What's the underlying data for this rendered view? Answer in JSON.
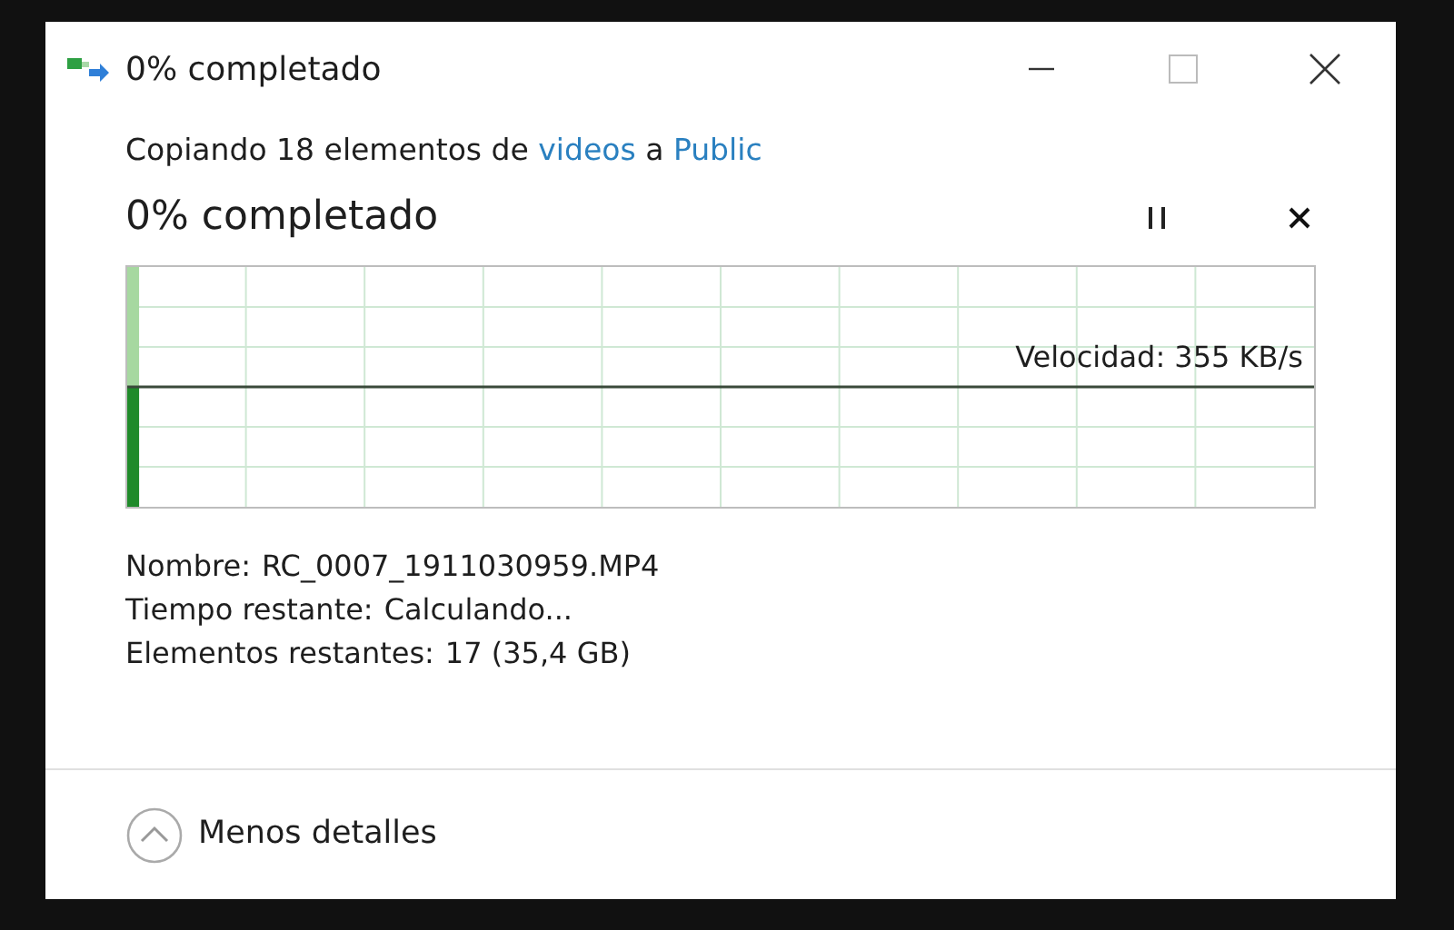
{
  "window": {
    "title": "0% completado"
  },
  "copy_line": {
    "prefix": "Copiando 18 elementos de ",
    "source": "videos",
    "middle": " a ",
    "destination": "Public"
  },
  "progress": {
    "heading": "0% completado",
    "level": 0.01,
    "speed": "Velocidad: 355 KB/s"
  },
  "details": [
    {
      "label": "Nombre:",
      "value": "RC_0007_1911030959.MP4"
    },
    {
      "label": "Tiempo restante:",
      "value": "Calculando..."
    },
    {
      "label": "Elementos restantes:",
      "value": "17 (35,4 GB)"
    }
  ],
  "footer": {
    "toggle": "Menos detalles",
    "expanded": true
  }
}
